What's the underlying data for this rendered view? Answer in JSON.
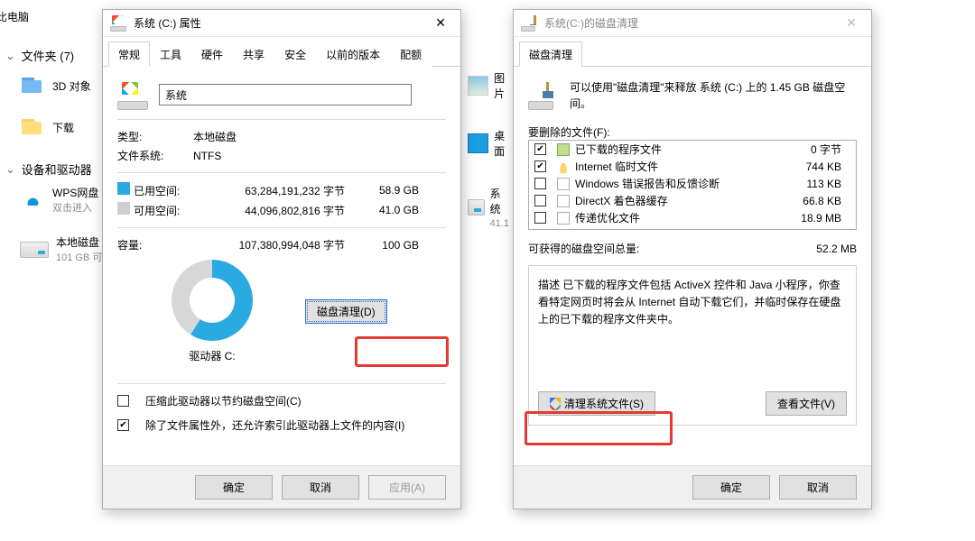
{
  "explorer": {
    "title": "比电脑",
    "folders_header": "文件夹 (7)",
    "devices_header": "设备和驱动器",
    "items": {
      "objects3d": "3D 对象",
      "downloads": "下载",
      "wps": "WPS网盘",
      "wps_sub": "双击进入",
      "localdisk": "本地磁盘",
      "localdisk_sub": "101 GB 可",
      "pictures": "图片",
      "desktop": "桌面",
      "system": "系统",
      "system_sub": "41.1"
    }
  },
  "props": {
    "title": "系统 (C:) 属性",
    "tabs": [
      "常规",
      "工具",
      "硬件",
      "共享",
      "安全",
      "以前的版本",
      "配额"
    ],
    "active_tab": 0,
    "drive_name": "系统",
    "type_label": "类型:",
    "type_value": "本地磁盘",
    "fs_label": "文件系统:",
    "fs_value": "NTFS",
    "used_label": "已用空间:",
    "used_bytes": "63,284,191,232 字节",
    "used_gb": "58.9 GB",
    "free_label": "可用空间:",
    "free_bytes": "44,096,802,816 字节",
    "free_gb": "41.0 GB",
    "cap_label": "容量:",
    "cap_bytes": "107,380,994,048 字节",
    "cap_gb": "100 GB",
    "ring_label": "驱动器 C:",
    "cleanup_btn": "磁盘清理(D)",
    "compress": "压缩此驱动器以节约磁盘空间(C)",
    "compress_checked": false,
    "index": "除了文件属性外，还允许索引此驱动器上文件的内容(I)",
    "index_checked": true,
    "ok": "确定",
    "cancel": "取消",
    "apply": "应用(A)"
  },
  "cleanup": {
    "title": "系统(C:)的磁盘清理",
    "tab": "磁盘清理",
    "intro": "可以使用\"磁盘清理\"来释放 系统 (C:) 上的 1.45 GB 磁盘空间。",
    "delete_label": "要删除的文件(F):",
    "files": [
      {
        "checked": true,
        "icon": "green",
        "name": "已下载的程序文件",
        "size": "0 字节"
      },
      {
        "checked": true,
        "icon": "lock",
        "name": "Internet 临时文件",
        "size": "744 KB"
      },
      {
        "checked": false,
        "icon": "blank",
        "name": "Windows 错误报告和反馈诊断",
        "size": "113 KB"
      },
      {
        "checked": false,
        "icon": "blank",
        "name": "DirectX 着色器缓存",
        "size": "66.8 KB"
      },
      {
        "checked": false,
        "icon": "blank",
        "name": "传递优化文件",
        "size": "18.9 MB"
      }
    ],
    "gain_label": "可获得的磁盘空间总量:",
    "gain_value": "52.2 MB",
    "desc_header": "描述",
    "desc_body": "已下载的程序文件包括 ActiveX 控件和 Java 小程序，你查看特定网页时将会从 Internet 自动下载它们，并临时保存在硬盘上的已下载的程序文件夹中。",
    "clean_sys_btn": "清理系统文件(S)",
    "view_btn": "查看文件(V)",
    "ok": "确定",
    "cancel": "取消"
  }
}
